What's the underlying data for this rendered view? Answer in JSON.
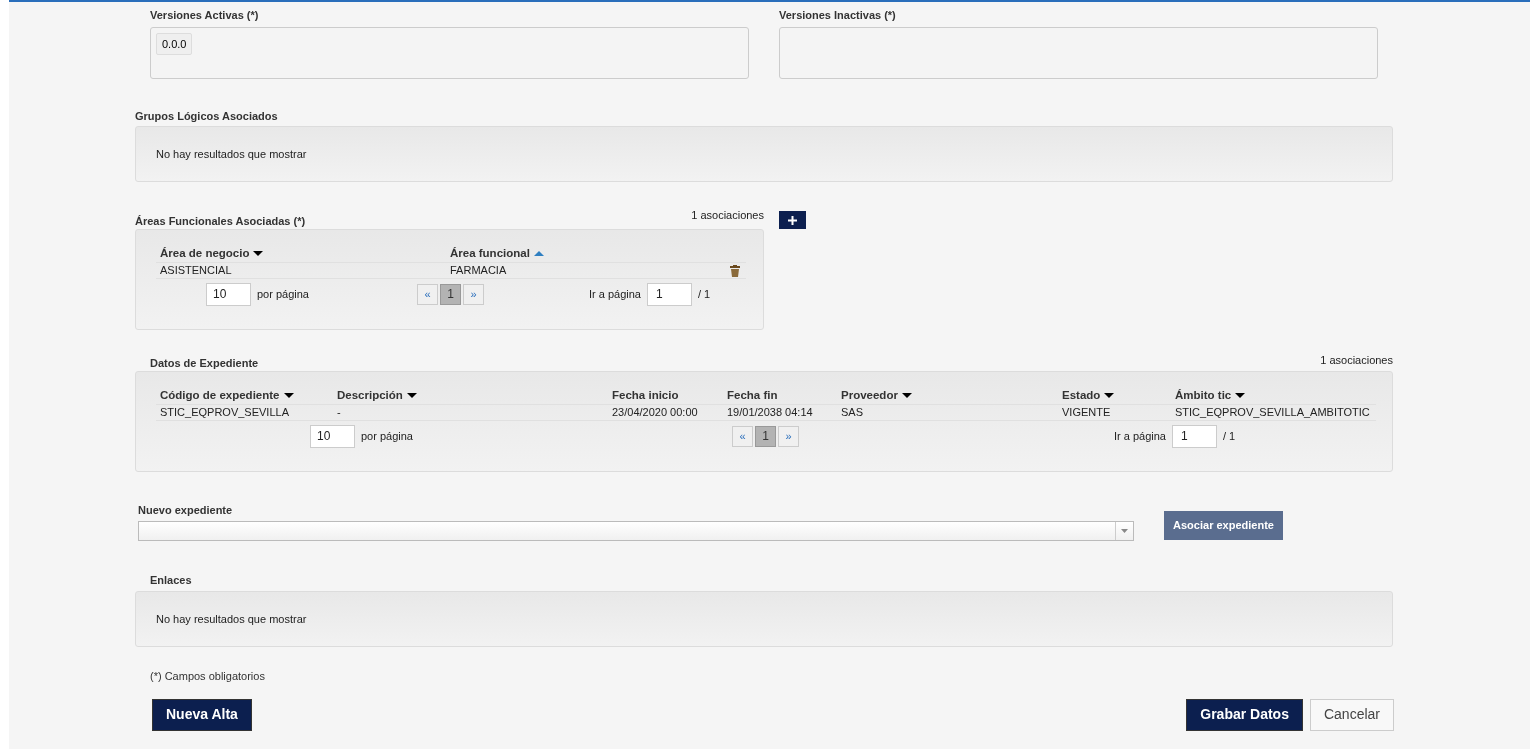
{
  "versiones_activas": {
    "label": "Versiones Activas (*)",
    "items": [
      "0.0.0"
    ]
  },
  "versiones_inactivas": {
    "label": "Versiones Inactivas (*)"
  },
  "grupos_logicos": {
    "label": "Grupos Lógicos Asociados",
    "empty": "No hay resultados que mostrar"
  },
  "areas_funcionales": {
    "label": "Áreas Funcionales Asociadas (*)",
    "count": "1 asociaciones",
    "columns": [
      {
        "label": "Área de negocio",
        "sorted": true,
        "ascending": false
      },
      {
        "label": "Área funcional",
        "sorted": true,
        "ascending": true
      }
    ],
    "rows": [
      [
        "ASISTENCIAL",
        "FARMACIA"
      ]
    ],
    "pager": {
      "per_page": "10",
      "per_page_label": "por página",
      "prev": "«",
      "pages": [
        {
          "label": "1",
          "selected": true
        }
      ],
      "next": "»",
      "goto_label": "Ir a página",
      "goto_value": "1",
      "total": "/ 1"
    }
  },
  "datos_expediente": {
    "label": "Datos de Expediente",
    "count": "1 asociaciones",
    "columns": [
      {
        "label": "Código de expediente",
        "sorted": true,
        "ascending": false
      },
      {
        "label": "Descripción",
        "sorted": true,
        "ascending": false
      },
      {
        "label": "Fecha inicio",
        "sorted": false
      },
      {
        "label": "Fecha fin",
        "sorted": false
      },
      {
        "label": "Proveedor",
        "sorted": true,
        "ascending": false
      },
      {
        "label": "Estado",
        "sorted": true,
        "ascending": false
      },
      {
        "label": "Ámbito tic",
        "sorted": true,
        "ascending": false
      }
    ],
    "rows": [
      [
        "STIC_EQPROV_SEVILLA",
        "-",
        "23/04/2020 00:00",
        "19/01/2038 04:14",
        "SAS",
        "VIGENTE",
        "STIC_EQPROV_SEVILLA_AMBITOTIC"
      ]
    ],
    "pager": {
      "per_page": "10",
      "per_page_label": "por página",
      "prev": "«",
      "pages": [
        {
          "label": "1",
          "selected": true
        }
      ],
      "next": "»",
      "goto_label": "Ir a página",
      "goto_value": "1",
      "total": "/ 1"
    }
  },
  "nuevo_expediente": {
    "label": "Nuevo expediente",
    "button": "Asociar expediente"
  },
  "enlaces": {
    "label": "Enlaces",
    "empty": "No hay resultados que mostrar"
  },
  "footnote": "(*) Campos obligatorios",
  "buttons": {
    "nueva_alta": "Nueva Alta",
    "grabar": "Grabar Datos",
    "cancelar": "Cancelar"
  }
}
